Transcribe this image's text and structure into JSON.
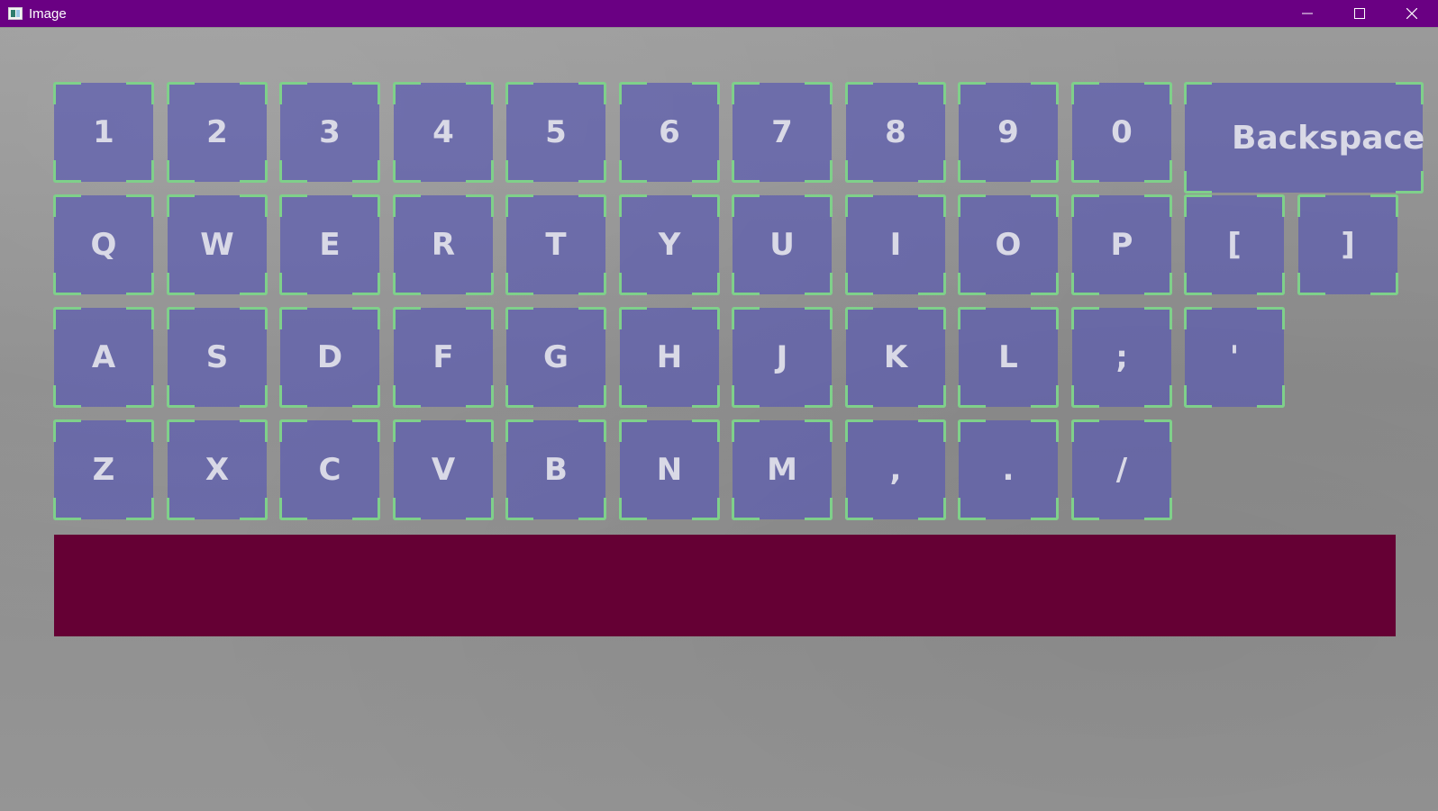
{
  "window": {
    "title": "Image",
    "controls": [
      "minimize",
      "maximize",
      "close"
    ]
  },
  "keyboard": {
    "rows": [
      [
        "1",
        "2",
        "3",
        "4",
        "5",
        "6",
        "7",
        "8",
        "9",
        "0",
        "Backspace"
      ],
      [
        "Q",
        "W",
        "E",
        "R",
        "T",
        "Y",
        "U",
        "I",
        "O",
        "P",
        "[",
        "]"
      ],
      [
        "A",
        "S",
        "D",
        "F",
        "G",
        "H",
        "J",
        "K",
        "L",
        ";",
        "'"
      ],
      [
        "Z",
        "X",
        "C",
        "V",
        "B",
        "N",
        "M",
        ",",
        ".",
        "/"
      ]
    ]
  },
  "text_field": {
    "value": ""
  },
  "colors": {
    "titlebar": "#6a0083",
    "key_fill": "#5c5cb0",
    "key_corner": "#7fd08a",
    "text_field": "#650034"
  }
}
